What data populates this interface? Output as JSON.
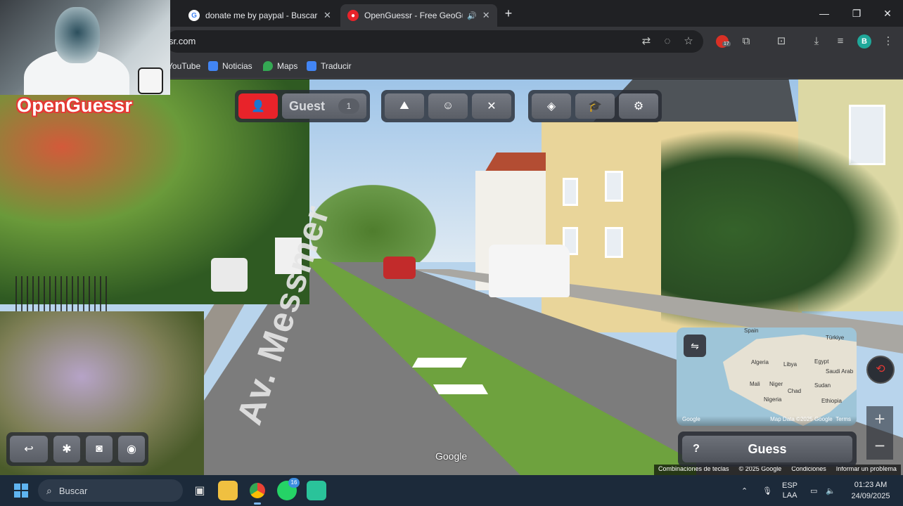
{
  "browser": {
    "tabs": [
      {
        "title": "donate me by paypal - Buscar c",
        "favicon": "google-icon"
      },
      {
        "title": "OpenGuessr - Free GeoGue",
        "favicon": "openguessr-icon",
        "active": true
      }
    ],
    "omnibox_url": "sr.com",
    "bookmarks": [
      "YouTube",
      "Noticias",
      "Maps",
      "Traducir"
    ],
    "profile_initial": "B",
    "extension_badge": "17"
  },
  "game": {
    "logo": "OpenGuessr",
    "player_name": "Guest",
    "player_count": "1",
    "guess_label": "Guess",
    "guess_help": "?",
    "zoom_in": "+",
    "zoom_out": "−",
    "street_name": "Av. Messmer",
    "google_watermark": "Google",
    "minimap": {
      "labels": [
        "Spain",
        "Türkiye",
        "Algeria",
        "Libya",
        "Egypt",
        "Saudi Arab",
        "Mali",
        "Niger",
        "Chad",
        "Sudan",
        "Nigeria",
        "Ethiopia"
      ],
      "google": "Google",
      "map_data": "Map Data ©2025 Google",
      "terms": "Terms"
    },
    "footer_links": [
      "Combinaciones de teclas",
      "© 2025 Google",
      "Condiciones",
      "Informar un problema"
    ]
  },
  "taskbar": {
    "search_placeholder": "Buscar",
    "whatsapp_badge": "16",
    "language": "ESP",
    "language_sub": "LAA",
    "time": "01:23 AM",
    "date": "24/09/2025"
  },
  "colors": {
    "accent_red": "#e8232a",
    "taskbar_bg": "#1c2a3a",
    "chrome_bg": "#202124"
  }
}
